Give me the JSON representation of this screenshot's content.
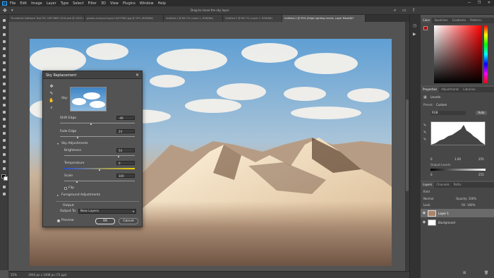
{
  "app": {
    "logo": "Ps"
  },
  "menu": [
    "File",
    "Edit",
    "Image",
    "Layer",
    "Type",
    "Select",
    "Filter",
    "3D",
    "View",
    "Plugins",
    "Window",
    "Help"
  ],
  "window_controls": {
    "minimize": "—",
    "restore": "❐",
    "close": "✕"
  },
  "options_bar": {
    "hint": "Drag to move the sky layer."
  },
  "tabs": [
    {
      "label": "Thumbnail Software Test-TSC OKTOBER 2018.psd @ 100% (Layer 7 copy, RGB/8#)",
      "active": false
    },
    {
      "label": "pexels-enrique-hoyos-14437983.jpg @ 25% (RGB/8#)",
      "active": false
    },
    {
      "label": "Untitled-1 @ 66.7% (Layer 1, RGB/8#)",
      "active": false
    },
    {
      "label": "Untitled-1 @ 66.7% (Layer 1, RGB/8#)",
      "active": false
    },
    {
      "label": "Untitled-1 @ 55% (Edge Lighting Levels, Layer Mask/8)*",
      "active": true
    }
  ],
  "status": {
    "zoom": "55%",
    "doc_info": "1944 px x 1008 px (72 ppi)"
  },
  "right_panels": {
    "color_tabs": [
      "Color",
      "Swatches",
      "Gradients",
      "Patterns"
    ],
    "props_tabs": [
      "Properties",
      "Adjustments",
      "Libraries"
    ],
    "props_title": "Levels",
    "preset_label": "Preset:",
    "preset_value": "Custom",
    "channel_value": "RGB",
    "auto_label": "Auto",
    "levels_input": [
      "0",
      "1.00",
      "255"
    ],
    "output_levels_label": "Output Levels:",
    "output_levels": [
      "0",
      "255"
    ],
    "layers_tabs": [
      "Layers",
      "Channels",
      "Paths"
    ],
    "layers_kind": "Kind",
    "blend_mode": "Normal",
    "opacity_label": "Opacity: 100%",
    "lock_label": "Lock:",
    "fill_label": "Fill: 100%",
    "layers": [
      {
        "name": "Layer 1",
        "selected": true
      },
      {
        "name": "Background",
        "selected": false
      }
    ]
  },
  "dialog": {
    "title": "Sky Replacement",
    "close": "✕",
    "sky_label": "Sky:",
    "shift_edge": {
      "label": "Shift Edge",
      "value": "-49",
      "fraction": 0.42
    },
    "fade_edge": {
      "label": "Fade Edge",
      "value": "24",
      "fraction": 0.24
    },
    "sky_adjustments": "Sky Adjustments",
    "brightness": {
      "label": "Brightness",
      "value": "54",
      "fraction": 0.77
    },
    "temperature": {
      "label": "Temperature",
      "value": "0",
      "fraction": 0.5
    },
    "scale": {
      "label": "Scale",
      "value": "100",
      "fraction": 0.18
    },
    "flip_label": "Flip",
    "foreground_adjustments": "Foreground Adjustments",
    "output_section": "Output",
    "output_to_label": "Output To:",
    "output_to_value": "New Layers",
    "preview_label": "Preview",
    "preview_checked": true,
    "ok_label": "OK",
    "cancel_label": "Cancel"
  },
  "colors": {
    "accent": "#31a8ff",
    "panel": "#535353",
    "chrome": "#2b2b2b"
  }
}
